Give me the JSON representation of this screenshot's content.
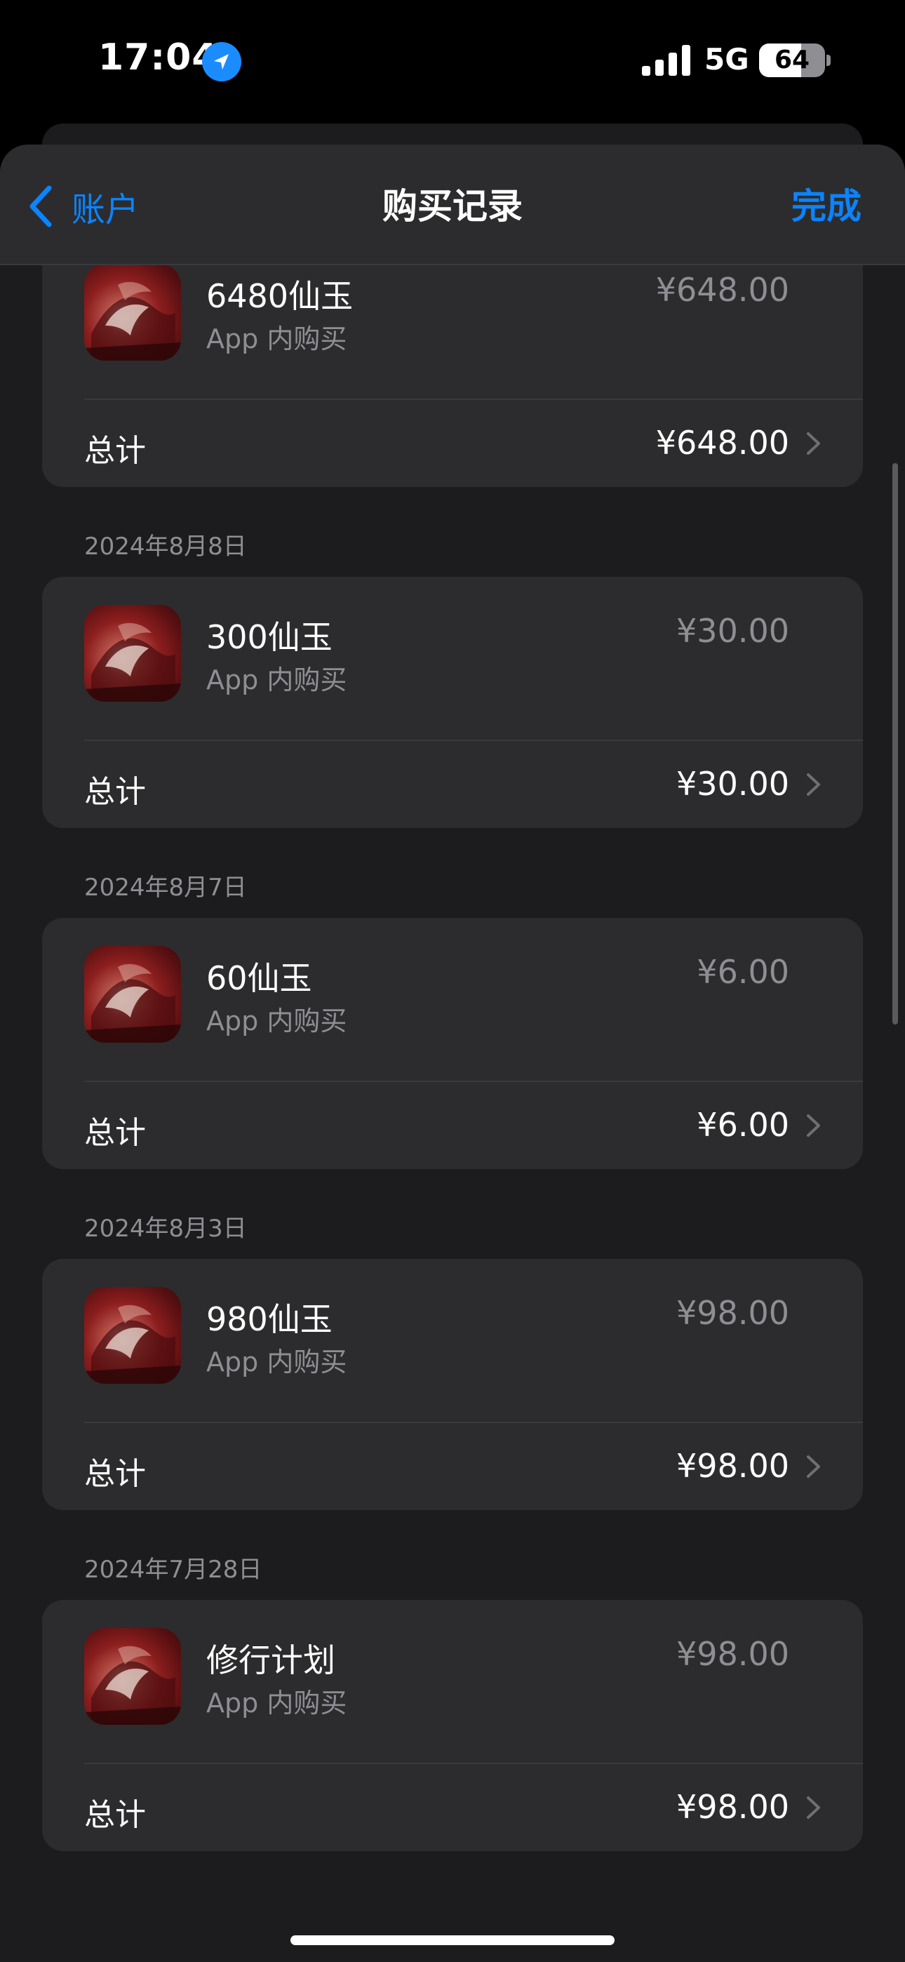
{
  "status_bar": {
    "time": "17:04",
    "network": "5G",
    "battery": "64",
    "battery_level": 0.64
  },
  "nav": {
    "back_label": "账户",
    "title": "购买记录",
    "done_label": "完成"
  },
  "sections": [
    {
      "date": "",
      "items": [
        {
          "name": "6480仙玉",
          "subtitle": "App 内购买",
          "price": "¥648.00"
        }
      ],
      "total_label": "总计",
      "total": "¥648.00"
    },
    {
      "date": "2024年8月8日",
      "items": [
        {
          "name": "300仙玉",
          "subtitle": "App 内购买",
          "price": "¥30.00"
        }
      ],
      "total_label": "总计",
      "total": "¥30.00"
    },
    {
      "date": "2024年8月7日",
      "items": [
        {
          "name": "60仙玉",
          "subtitle": "App 内购买",
          "price": "¥6.00"
        }
      ],
      "total_label": "总计",
      "total": "¥6.00"
    },
    {
      "date": "2024年8月3日",
      "items": [
        {
          "name": "980仙玉",
          "subtitle": "App 内购买",
          "price": "¥98.00"
        }
      ],
      "total_label": "总计",
      "total": "¥98.00"
    },
    {
      "date": "2024年7月28日",
      "items": [
        {
          "name": "修行计划",
          "subtitle": "App 内购买",
          "price": "¥98.00"
        }
      ],
      "total_label": "总计",
      "total": "¥98.00"
    }
  ],
  "colors": {
    "accent": "#0a84ff",
    "background": "#1c1c1e",
    "card": "#2c2c2e",
    "secondary_text": "#8e8e93"
  }
}
